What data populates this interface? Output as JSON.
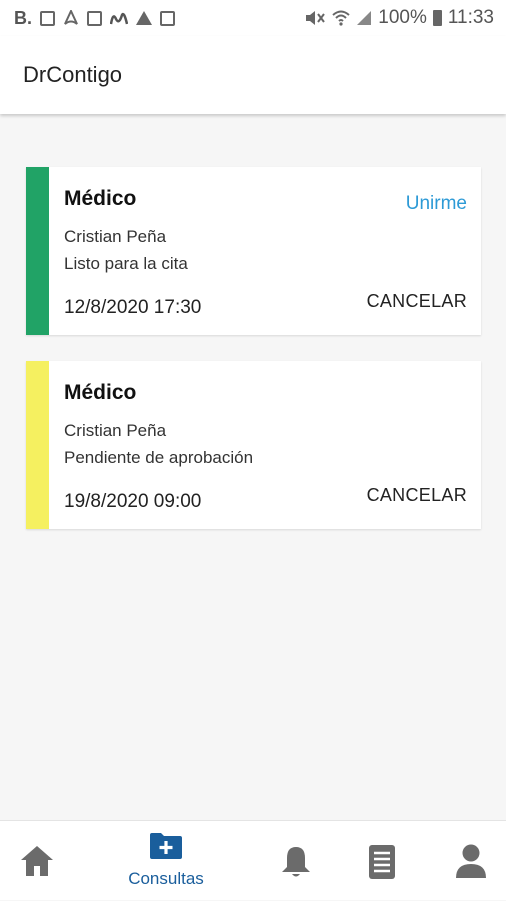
{
  "status_bar": {
    "left_letter": "B.",
    "battery": "100%",
    "time": "11:33"
  },
  "app": {
    "title": "DrContigo"
  },
  "appointments": [
    {
      "type": "Médico",
      "doctor": "Cristian Peña",
      "status": "Listo para la cita",
      "datetime": "12/8/2020 17:30",
      "join_label": "Unirme",
      "cancel_label": "CANCELAR",
      "status_color": "#21a366"
    },
    {
      "type": "Médico",
      "doctor": "Cristian Peña",
      "status": "Pendiente de aprobación",
      "datetime": "19/8/2020 09:00",
      "cancel_label": "CANCELAR",
      "status_color": "#f5f060"
    }
  ],
  "bottom_nav": {
    "items": [
      {
        "icon": "home-icon"
      },
      {
        "icon": "folder-plus-icon",
        "label": "Consultas",
        "active": true
      },
      {
        "icon": "bell-icon"
      },
      {
        "icon": "document-list-icon"
      },
      {
        "icon": "person-icon"
      }
    ]
  },
  "colors": {
    "accent": "#2d9ad6",
    "nav_active": "#1a5e9c",
    "nav_inactive": "#6b6b6b"
  }
}
